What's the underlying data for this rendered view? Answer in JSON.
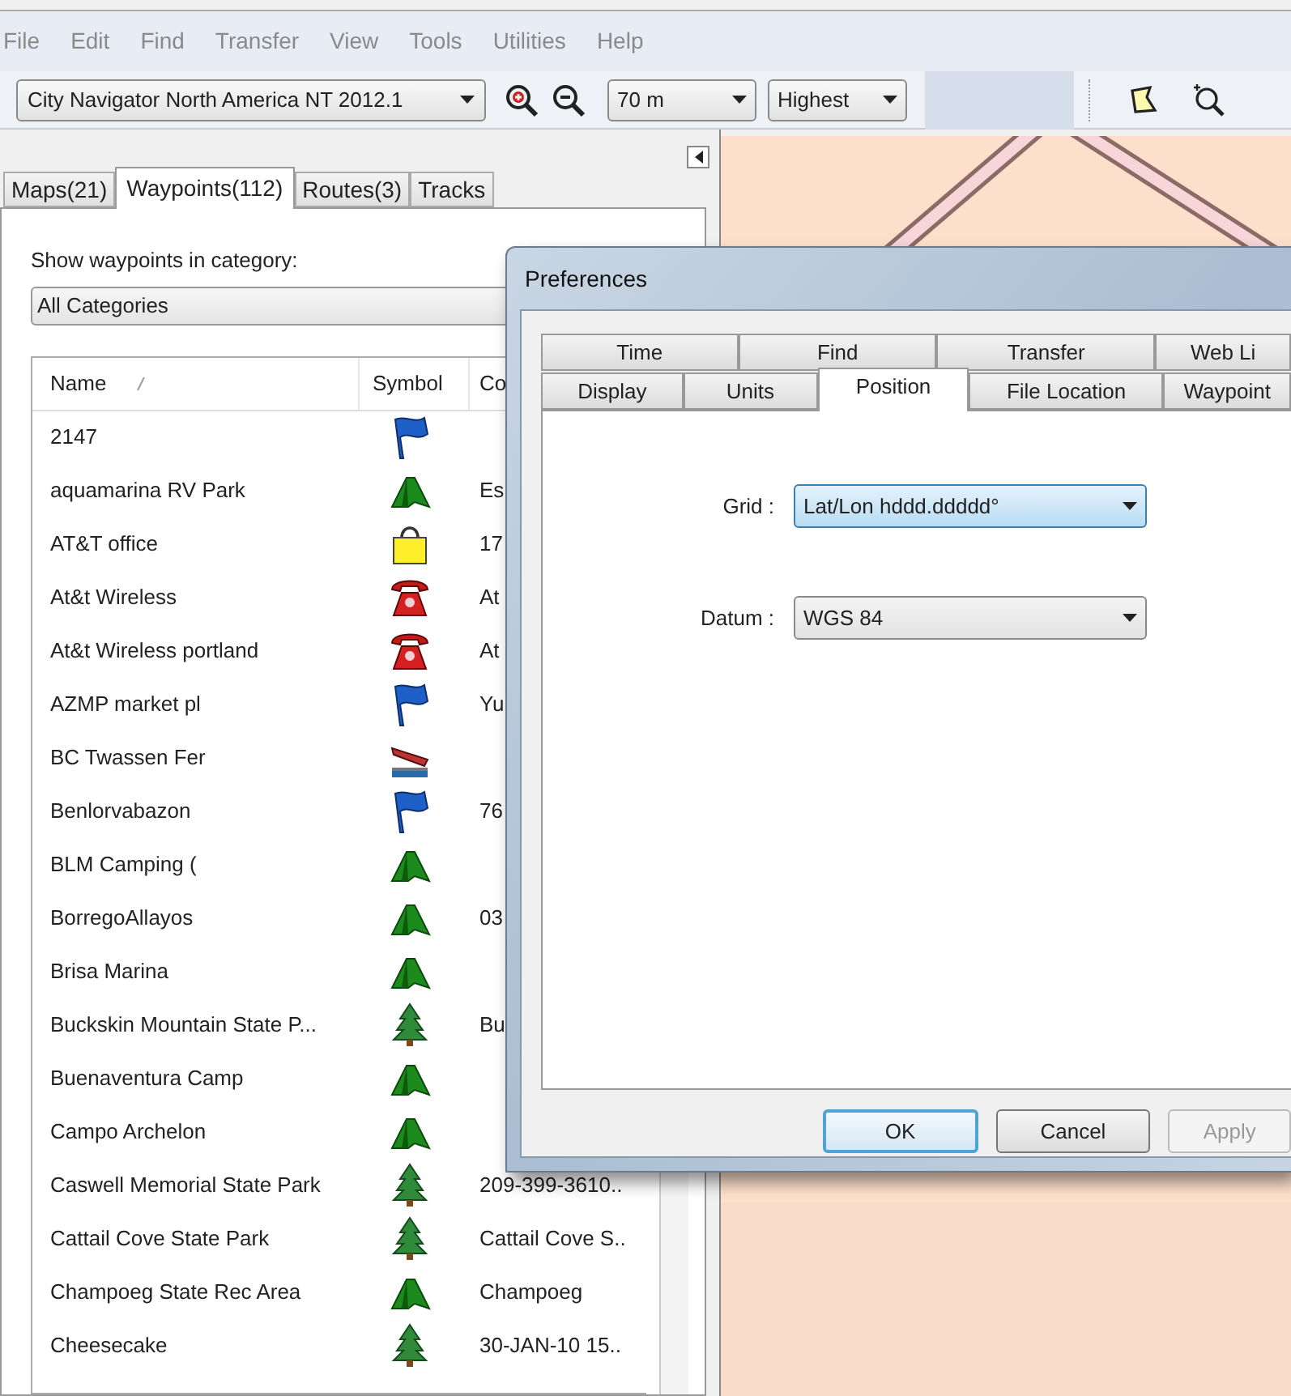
{
  "menu": [
    "File",
    "Edit",
    "Find",
    "Transfer",
    "View",
    "Tools",
    "Utilities",
    "Help"
  ],
  "toolbar": {
    "map_product": "City Navigator North America NT 2012.1",
    "zoom_level": "70 m",
    "detail": "Highest"
  },
  "panel_tabs": [
    {
      "label": "Maps(21)",
      "selected": false
    },
    {
      "label": "Waypoints(112)",
      "selected": true
    },
    {
      "label": "Routes(3)",
      "selected": false
    },
    {
      "label": "Tracks",
      "selected": false
    }
  ],
  "category_label": "Show waypoints in category:",
  "category": "All Categories",
  "table": {
    "columns": [
      "Name",
      "Symbol",
      "Co"
    ],
    "rows": [
      {
        "name": "2147",
        "kind": "flag",
        "comment": ""
      },
      {
        "name": "aquamarina RV Park",
        "kind": "tent",
        "comment": "Es"
      },
      {
        "name": "AT&T office",
        "kind": "bag",
        "comment": "17"
      },
      {
        "name": "At&t Wireless",
        "kind": "phone",
        "comment": "At"
      },
      {
        "name": "At&t Wireless portland",
        "kind": "phone",
        "comment": "At"
      },
      {
        "name": "AZMP market pl",
        "kind": "flag",
        "comment": "Yu"
      },
      {
        "name": "BC Twassen Fer",
        "kind": "ferry",
        "comment": ""
      },
      {
        "name": "Benlorvabazon",
        "kind": "flag",
        "comment": "76"
      },
      {
        "name": "BLM Camping (",
        "kind": "tent",
        "comment": ""
      },
      {
        "name": "BorregoAllayos",
        "kind": "tent",
        "comment": "03"
      },
      {
        "name": "Brisa Marina",
        "kind": "tent",
        "comment": ""
      },
      {
        "name": "Buckskin Mountain State P...",
        "kind": "tree",
        "comment": "Bu"
      },
      {
        "name": "Buenaventura Camp",
        "kind": "tent",
        "comment": ""
      },
      {
        "name": "Campo Archelon",
        "kind": "tent",
        "comment": ""
      },
      {
        "name": "Caswell Memorial State Park",
        "kind": "tree",
        "comment": "209-399-3610.."
      },
      {
        "name": "Cattail Cove State Park",
        "kind": "tree",
        "comment": "Cattail Cove S.."
      },
      {
        "name": "Champoeg State Rec Area",
        "kind": "tent",
        "comment": "Champoeg"
      },
      {
        "name": "Cheesecake",
        "kind": "tree",
        "comment": "30-JAN-10 15.."
      }
    ]
  },
  "dialog": {
    "title": "Preferences",
    "tab_rows": [
      [
        {
          "label": "Time",
          "selected": false
        },
        {
          "label": "Find",
          "selected": false
        },
        {
          "label": "Transfer",
          "selected": false
        },
        {
          "label": "Web Li",
          "selected": false
        }
      ],
      [
        {
          "label": "Display",
          "selected": false
        },
        {
          "label": "Units",
          "selected": false
        },
        {
          "label": "Position",
          "selected": true
        },
        {
          "label": "File Location",
          "selected": false
        },
        {
          "label": "Waypoint",
          "selected": false
        }
      ]
    ],
    "fields": [
      {
        "label": "Grid :",
        "value": "Lat/Lon hddd.ddddd°",
        "focused": true
      },
      {
        "label": "Datum :",
        "value": "WGS 84",
        "focused": false
      }
    ],
    "buttons": [
      {
        "label": "OK",
        "default": true,
        "disabled": false
      },
      {
        "label": "Cancel",
        "default": false,
        "disabled": false
      },
      {
        "label": "Apply",
        "default": false,
        "disabled": true
      }
    ]
  }
}
